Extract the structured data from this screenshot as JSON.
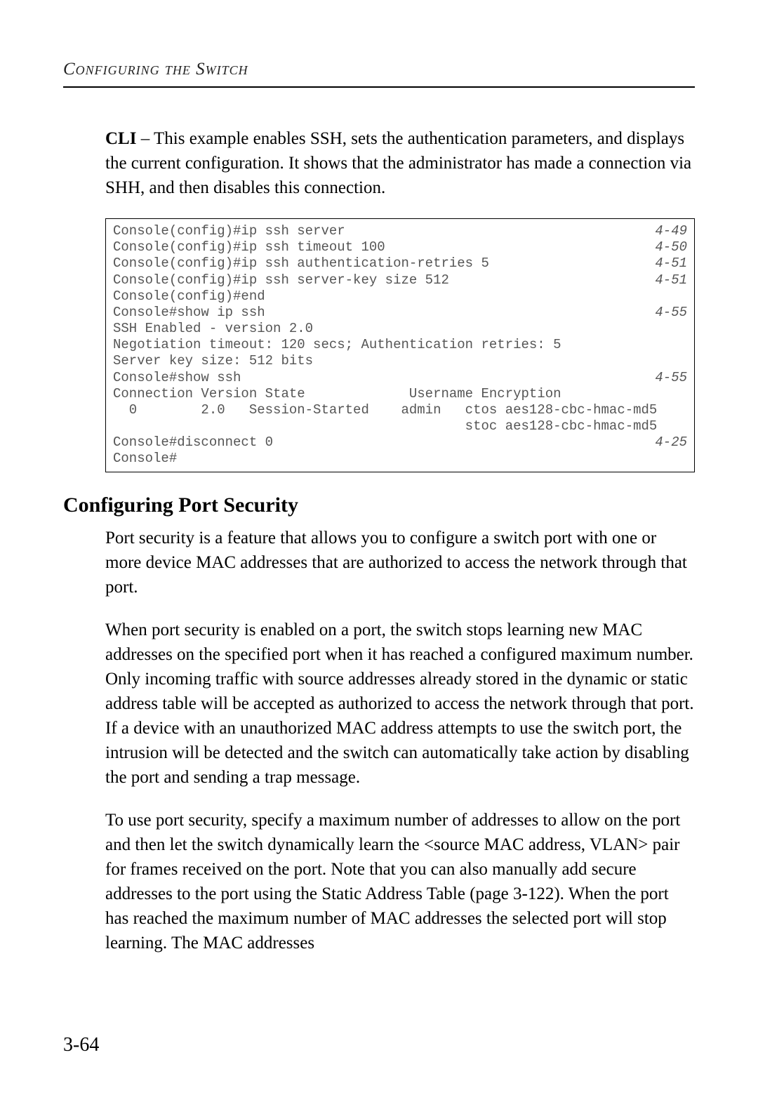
{
  "runningHead": "Configuring the Switch",
  "intro": {
    "leadLabel": "CLI",
    "leadText": " – This example enables SSH, sets the authentication parameters, and displays the current configuration. It shows that the administrator has made a connection via SHH, and then disables this connection."
  },
  "code": {
    "lines": [
      {
        "text": "Console(config)#ip ssh server",
        "ref": "4-49"
      },
      {
        "text": "Console(config)#ip ssh timeout 100",
        "ref": "4-50"
      },
      {
        "text": "Console(config)#ip ssh authentication-retries 5",
        "ref": "4-51"
      },
      {
        "text": "Console(config)#ip ssh server-key size 512",
        "ref": "4-51"
      },
      {
        "text": "Console(config)#end",
        "ref": ""
      },
      {
        "text": "Console#show ip ssh",
        "ref": "4-55"
      },
      {
        "text": "SSH Enabled - version 2.0",
        "ref": ""
      },
      {
        "text": "Negotiation timeout: 120 secs; Authentication retries: 5",
        "ref": ""
      },
      {
        "text": "Server key size: 512 bits",
        "ref": ""
      },
      {
        "text": "Console#show ssh",
        "ref": "4-55"
      },
      {
        "text": "Connection Version State             Username Encryption",
        "ref": ""
      },
      {
        "text": "  0        2.0   Session-Started    admin   ctos aes128-cbc-hmac-md5",
        "ref": ""
      },
      {
        "text": "                                            stoc aes128-cbc-hmac-md5",
        "ref": ""
      },
      {
        "text": "Console#disconnect 0",
        "ref": "4-25"
      },
      {
        "text": "Console#",
        "ref": ""
      }
    ]
  },
  "sectionTitle": "Configuring Port Security",
  "paragraphs": {
    "p1": "Port security is a feature that allows you to configure a switch port with one or more device MAC addresses that are authorized to access the network through that port.",
    "p2": "When port security is enabled on a port, the switch stops learning new MAC addresses on the specified port when it has reached a configured maximum number. Only incoming traffic with source addresses already stored in the dynamic or static address table will be accepted as authorized to access the network through that port. If a device with an unauthorized MAC address attempts to use the switch port, the intrusion will be detected and the switch can automatically take action by disabling the port and sending a trap message.",
    "p3": "To use port security, specify a maximum number of addresses to allow on the port and then let the switch dynamically learn the <source MAC address, VLAN> pair for frames received on the port. Note that you can also manually add secure addresses to the port using the Static Address Table (page 3-122). When the port has reached the maximum number of MAC addresses the selected port will stop learning. The MAC addresses"
  },
  "pageNumber": "3-64"
}
